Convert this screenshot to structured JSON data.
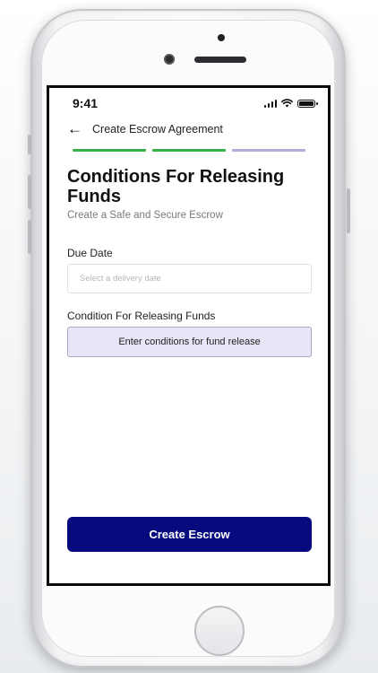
{
  "status_bar": {
    "time": "9:41"
  },
  "header": {
    "back_icon": "back-arrow-icon",
    "title": "Create Escrow Agreement"
  },
  "progress": {
    "steps_total": 3,
    "colors": {
      "done": "#36b24a",
      "active": "#b1acd7"
    }
  },
  "page": {
    "title": "Conditions For Releasing Funds",
    "subtitle": "Create a Safe and Secure Escrow"
  },
  "due_date": {
    "label": "Due Date",
    "placeholder": "Select a delivery date",
    "value": ""
  },
  "conditions": {
    "label": "Condition For Releasing Funds",
    "button_text": "Enter conditions for fund release"
  },
  "actions": {
    "create_label": "Create Escrow"
  },
  "colors": {
    "primary": "#070a7e",
    "condition_bg": "#e7e6f6",
    "condition_border": "#a9a8c7"
  }
}
